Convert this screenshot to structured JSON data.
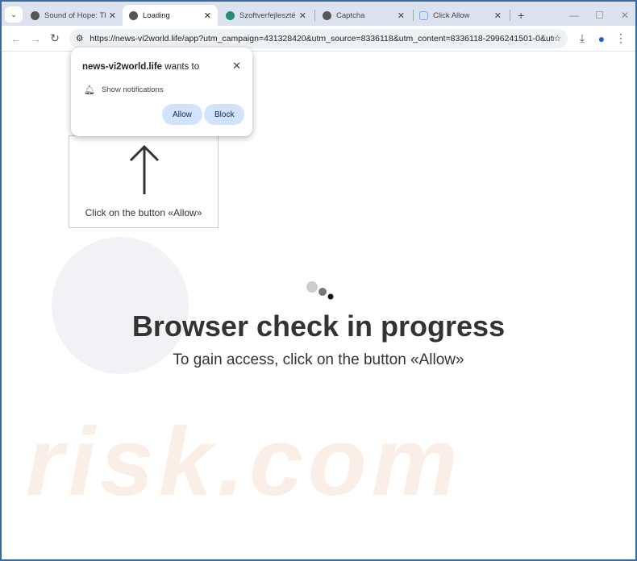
{
  "tabs": [
    {
      "title": "Sound of Hope: Th",
      "active": false
    },
    {
      "title": "Loading",
      "active": true
    },
    {
      "title": "Szoftverfejlesztés",
      "active": false
    },
    {
      "title": "Captcha",
      "active": false
    },
    {
      "title": "Click Allow",
      "active": false
    }
  ],
  "address_bar": {
    "url": "https://news-vi2world.life/app?utm_campaign=431328420&utm_source=8336118&utm_content=8336118-2996241501-0&utm..."
  },
  "permission_popup": {
    "site": "news-vi2world.life",
    "suffix": " wants to",
    "permission": "Show notifications",
    "allow": "Allow",
    "block": "Block"
  },
  "instruction": {
    "text": "Click on the button «Allow»"
  },
  "main": {
    "heading": "Browser check in progress",
    "subheading": "To gain access, click on the button «Allow»"
  },
  "watermark": "risk.com"
}
